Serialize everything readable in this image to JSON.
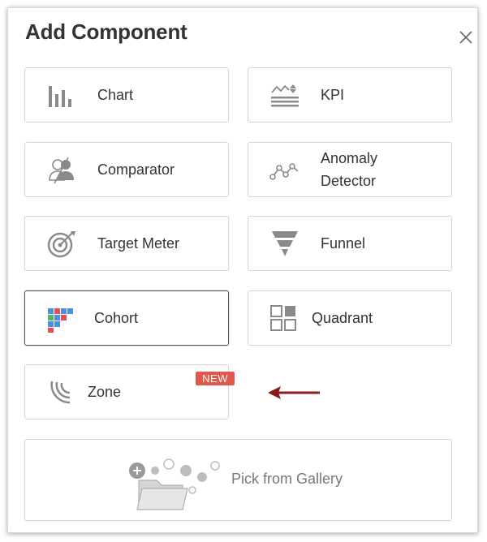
{
  "dialog": {
    "title": "Add Component",
    "close_label": "×"
  },
  "components": [
    {
      "label": "Chart",
      "icon": "bar-chart-icon"
    },
    {
      "label": "KPI",
      "icon": "kpi-icon"
    },
    {
      "label": "Comparator",
      "icon": "comparator-icon"
    },
    {
      "label": "Anomaly Detector",
      "icon": "anomaly-detector-icon"
    },
    {
      "label": "Target Meter",
      "icon": "target-icon"
    },
    {
      "label": "Funnel",
      "icon": "funnel-icon"
    },
    {
      "label": "Cohort",
      "icon": "cohort-icon",
      "selected": true
    },
    {
      "label": "Quadrant",
      "icon": "quadrant-icon"
    },
    {
      "label": "Zone",
      "icon": "zone-icon",
      "badge": "NEW"
    }
  ],
  "gallery": {
    "label": "Pick from Gallery",
    "icon": "gallery-folder-icon"
  },
  "colors": {
    "icon_gray": "#8a8a8a",
    "badge": "#e2574c",
    "arrow": "#8b1a1a",
    "cohort_blue": "#4a8fe0",
    "cohort_red": "#e05252",
    "cohort_green": "#52b36a"
  }
}
